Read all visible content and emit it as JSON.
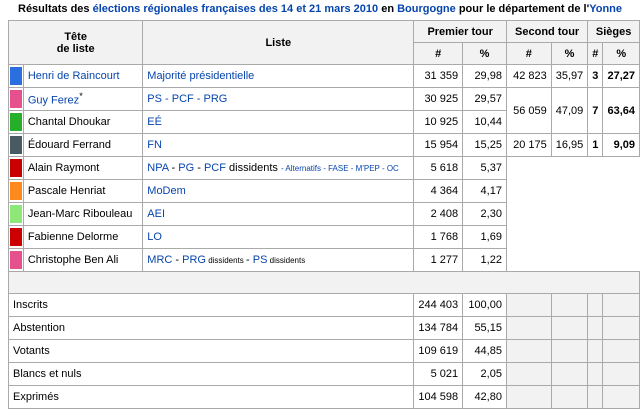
{
  "caption": {
    "p1": "Résultats des ",
    "link1": "élections régionales françaises des 14 et 21 mars 2010",
    "p2": " en ",
    "link2": "Bourgogne",
    "p3": " pour le département de l'",
    "link3": "Yonne"
  },
  "headers": {
    "tete": "Tête",
    "de_liste": "de liste",
    "liste": "Liste",
    "premier_tour": "Premier tour",
    "second_tour": "Second tour",
    "sieges": "Sièges",
    "hash": "#",
    "pct": "%"
  },
  "rows": [
    {
      "color": "#2a6ee0",
      "tete": "Henri de Raincourt",
      "liste": "Majorité présidentielle",
      "t1n": "31 359",
      "t1p": "29,98",
      "t2n": "42 823",
      "t2p": "35,97",
      "sn": "3",
      "sp": "27,27"
    },
    {
      "color": "#e6508c",
      "tete": "Guy Ferez",
      "star": "*",
      "liste": "PS - PCF - PRG",
      "t1n": "30 925",
      "t1p": "29,57"
    },
    {
      "color": "#26b02a",
      "tete": "Chantal Dhoukar",
      "liste": "EÉ",
      "t1n": "10 925",
      "t1p": "10,44"
    },
    {
      "color": "#4a5a62",
      "tete": "Édouard Ferrand",
      "liste": "FN",
      "t1n": "15 954",
      "t1p": "15,25",
      "t2n": "20 175",
      "t2p": "16,95",
      "sn": "1",
      "sp": "9,09"
    },
    {
      "color": "#c80000",
      "tete": "Alain Raymont",
      "t1n": "5 618",
      "t1p": "5,37"
    },
    {
      "color": "#ff8a1c",
      "tete": "Pascale Henriat",
      "liste": "MoDem",
      "t1n": "4 364",
      "t1p": "4,17"
    },
    {
      "color": "#8ee878",
      "tete": "Jean-Marc Ribouleau",
      "liste": "AEI",
      "t1n": "2 408",
      "t1p": "2,30"
    },
    {
      "color": "#cc0000",
      "tete": "Fabienne Delorme",
      "liste": "LO",
      "t1n": "1 768",
      "t1p": "1,69"
    },
    {
      "color": "#e6508c",
      "tete": "Christophe Ben Ali",
      "t1n": "1 277",
      "t1p": "1,22"
    }
  ],
  "merged_psfc": {
    "t2n": "56 059",
    "t2p": "47,09",
    "sn": "7",
    "sp": "63,64"
  },
  "npa": {
    "l1": "NPA",
    "s1": " - ",
    "l2": "PG",
    "s2": " - ",
    "l3": "PCF",
    "s3": " dissidents ",
    "small": "- Alternatifs - FASE - M'PEP - OC"
  },
  "mrc": {
    "l1": "MRC",
    "s1": " - ",
    "l2": "PRG",
    "small1": " dissidents ",
    "s2": "- ",
    "l3": "PS",
    "small2": " dissidents"
  },
  "totals": [
    {
      "label": "Inscrits",
      "n": "244 403",
      "p": "100,00"
    },
    {
      "label": "Abstention",
      "n": "134 784",
      "p": "55,15"
    },
    {
      "label": "Votants",
      "n": "109 619",
      "p": "44,85"
    },
    {
      "label": "Blancs et nuls",
      "n": "5 021",
      "p": "2,05"
    },
    {
      "label": "Exprimés",
      "n": "104 598",
      "p": "42,80"
    }
  ]
}
